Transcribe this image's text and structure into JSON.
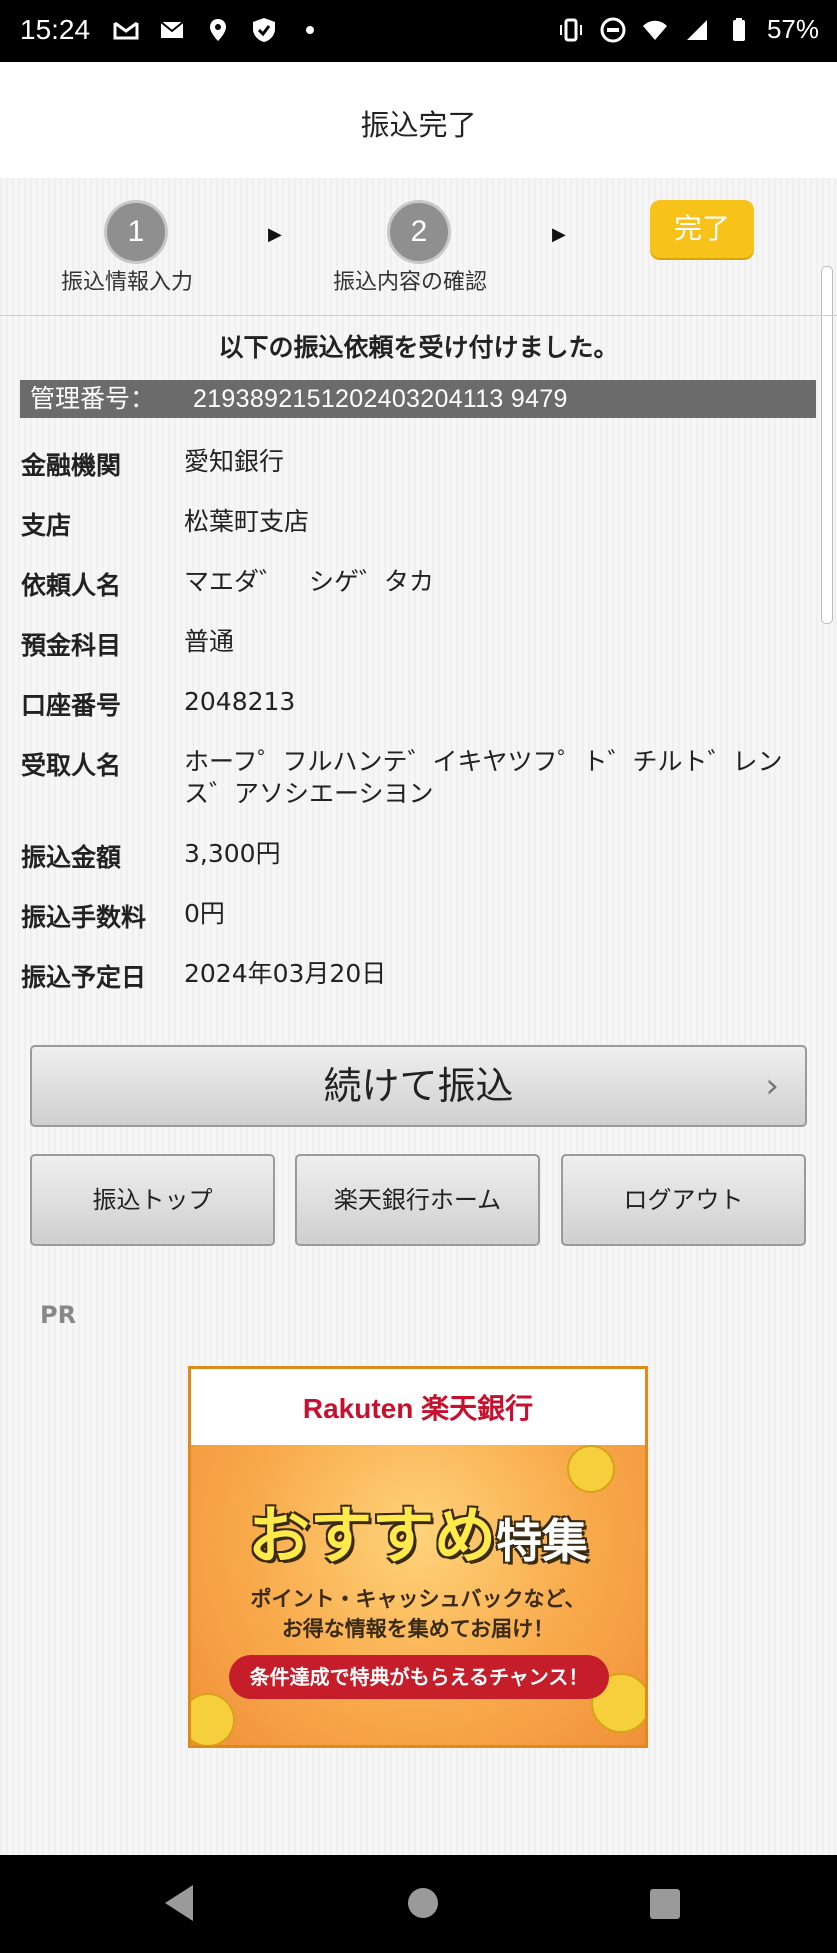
{
  "status_bar": {
    "time": "15:24",
    "battery": "57%"
  },
  "header": {
    "title": "振込完了"
  },
  "steps": [
    {
      "number": "1",
      "label": "振込情報入力"
    },
    {
      "number": "2",
      "label": "振込内容の確認"
    },
    {
      "label": "完了"
    }
  ],
  "message": "以下の振込依頼を受け付けました。",
  "management": {
    "label": "管理番号：",
    "value": "2193892151202403204113 9479"
  },
  "details": [
    {
      "key": "金融機関",
      "value": "愛知銀行"
    },
    {
      "key": "支店",
      "value": "松葉町支店"
    },
    {
      "key": "依頼人名",
      "value": "マエダ゛　シゲ゛タカ"
    },
    {
      "key": "預金科目",
      "value": "普通"
    },
    {
      "key": "口座番号",
      "value": "2048213"
    },
    {
      "key": "受取人名",
      "value": "ホーフ゜フルハンテ゛イキヤツフ゜ト゛チルト゛レンス゛アソシエーシヨン"
    },
    {
      "key": "振込金額",
      "value": "3,300円"
    },
    {
      "key": "振込手数料",
      "value": "0円"
    },
    {
      "key": "振込予定日",
      "value": "2024年03月20日"
    }
  ],
  "buttons": {
    "continue": "続けて振込",
    "transfer_top": "振込トップ",
    "rakuten_home": "楽天銀行ホーム",
    "logout": "ログアウト"
  },
  "pr_label": "PR",
  "banner": {
    "brand": "Rakuten 楽天銀行",
    "headline_main": "おすすめ",
    "headline_sub": "特集",
    "line1": "ポイント・キャッシュバックなど、",
    "line2": "お得な情報を集めてお届け！",
    "cta": "条件達成で特典がもらえるチャンス！"
  }
}
